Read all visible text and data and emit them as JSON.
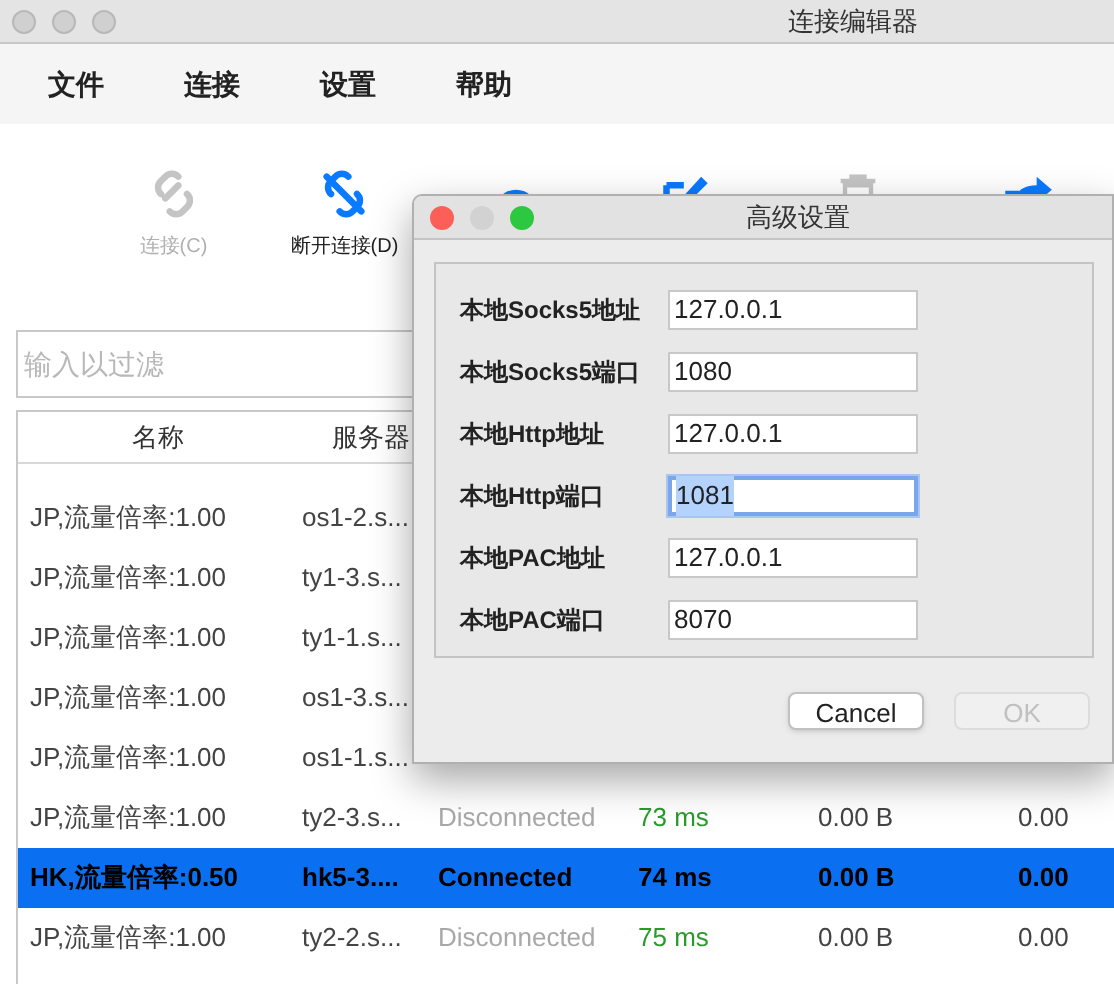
{
  "window": {
    "title": "连接编辑器"
  },
  "menu": [
    {
      "label": "文件"
    },
    {
      "label": "连接"
    },
    {
      "label": "设置"
    },
    {
      "label": "帮助"
    }
  ],
  "toolbar": [
    {
      "kind": "link",
      "label": "连接(C)",
      "disabled": true
    },
    {
      "kind": "unlink",
      "label": "断开连接(D)",
      "disabled": false
    },
    {
      "kind": "gauge",
      "disabled": false
    },
    {
      "kind": "edit",
      "disabled": false
    },
    {
      "kind": "trash",
      "disabled": true
    },
    {
      "kind": "share",
      "disabled": false
    }
  ],
  "filter": {
    "placeholder": "输入以过滤"
  },
  "table": {
    "columns": [
      "名称",
      "服务器"
    ],
    "rows": [
      {
        "name": "JP,流量倍率:1.00",
        "server": "os1-2.s...",
        "selected": false
      },
      {
        "name": "JP,流量倍率:1.00",
        "server": "ty1-3.s...",
        "selected": false
      },
      {
        "name": "JP,流量倍率:1.00",
        "server": "ty1-1.s...",
        "selected": false
      },
      {
        "name": "JP,流量倍率:1.00",
        "server": "os1-3.s...",
        "selected": false
      },
      {
        "name": "JP,流量倍率:1.00",
        "server": "os1-1.s...",
        "selected": false
      },
      {
        "name": "JP,流量倍率:1.00",
        "server": "ty2-3.s...",
        "status": "Disconnected",
        "connected": false,
        "latency": "73 ms",
        "upload": "0.00 B",
        "download": "0.00",
        "selected": false
      },
      {
        "name": "HK,流量倍率:0.50",
        "server": "hk5-3....",
        "status": "Connected",
        "connected": true,
        "latency": "74 ms",
        "upload": "0.00 B",
        "download": "0.00",
        "selected": true
      },
      {
        "name": "JP,流量倍率:1.00",
        "server": "ty2-2.s...",
        "status": "Disconnected",
        "connected": false,
        "latency": "75 ms",
        "upload": "0.00 B",
        "download": "0.00",
        "selected": false
      }
    ]
  },
  "dialog": {
    "title": "高级设置",
    "fields": [
      {
        "label": "本地Socks5地址",
        "value": "127.0.0.1",
        "focused": false
      },
      {
        "label": "本地Socks5端口",
        "value": "1080",
        "focused": false
      },
      {
        "label": "本地Http地址",
        "value": "127.0.0.1",
        "focused": false
      },
      {
        "label": "本地Http端口",
        "value": "1081",
        "focused": true
      },
      {
        "label": "本地PAC地址",
        "value": "127.0.0.1",
        "focused": false
      },
      {
        "label": "本地PAC端口",
        "value": "8070",
        "focused": false
      }
    ],
    "buttons": [
      {
        "label": "Cancel",
        "disabled": false
      },
      {
        "label": "OK",
        "disabled": true
      }
    ]
  }
}
